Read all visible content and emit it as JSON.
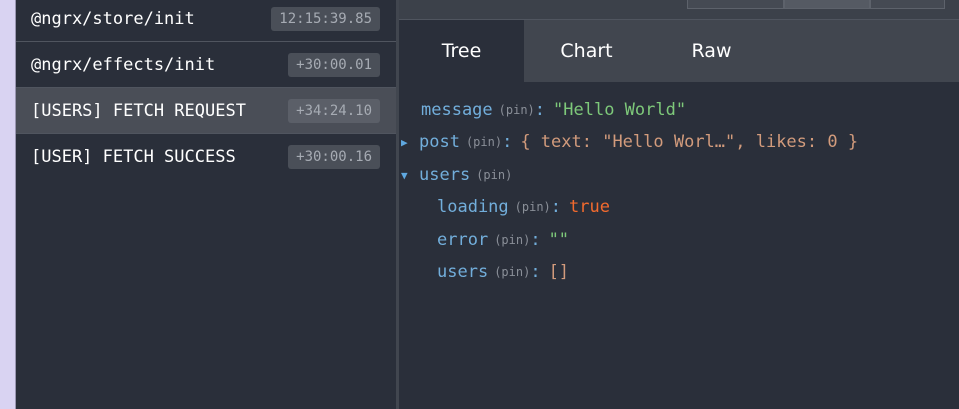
{
  "actions": [
    {
      "name": "@ngrx/store/init",
      "time": "12:15:39.85",
      "selected": false
    },
    {
      "name": "@ngrx/effects/init",
      "time": "+30:00.01",
      "selected": false
    },
    {
      "name": "[USERS] FETCH REQUEST",
      "time": "+34:24.10",
      "selected": true
    },
    {
      "name": "[USER] FETCH SUCCESS",
      "time": "+30:00.16",
      "selected": false
    }
  ],
  "tabs": {
    "tree": "Tree",
    "chart": "Chart",
    "raw": "Raw",
    "active": "Tree"
  },
  "state_tree": {
    "message": {
      "key": "message",
      "pin": "(pin)",
      "value": "\"Hello World\""
    },
    "post": {
      "arrow": "▶",
      "key": "post",
      "pin": "(pin)",
      "value": "{ text: \"Hello Worl…\", likes: 0 }"
    },
    "users": {
      "arrow": "▼",
      "key": "users",
      "pin": "(pin)"
    },
    "loading": {
      "key": "loading",
      "pin": "(pin)",
      "value": "true"
    },
    "error": {
      "key": "error",
      "pin": "(pin)",
      "value": "\"\""
    },
    "users_inner": {
      "key": "users",
      "pin": "(pin)",
      "value": "[]"
    }
  },
  "colors": {
    "background": "#2a2f3a",
    "selected_row": "#4a4e57",
    "key": "#72aedb",
    "string": "#7ec97a",
    "boolean": "#f26a2e",
    "object": "#d29b7c"
  }
}
